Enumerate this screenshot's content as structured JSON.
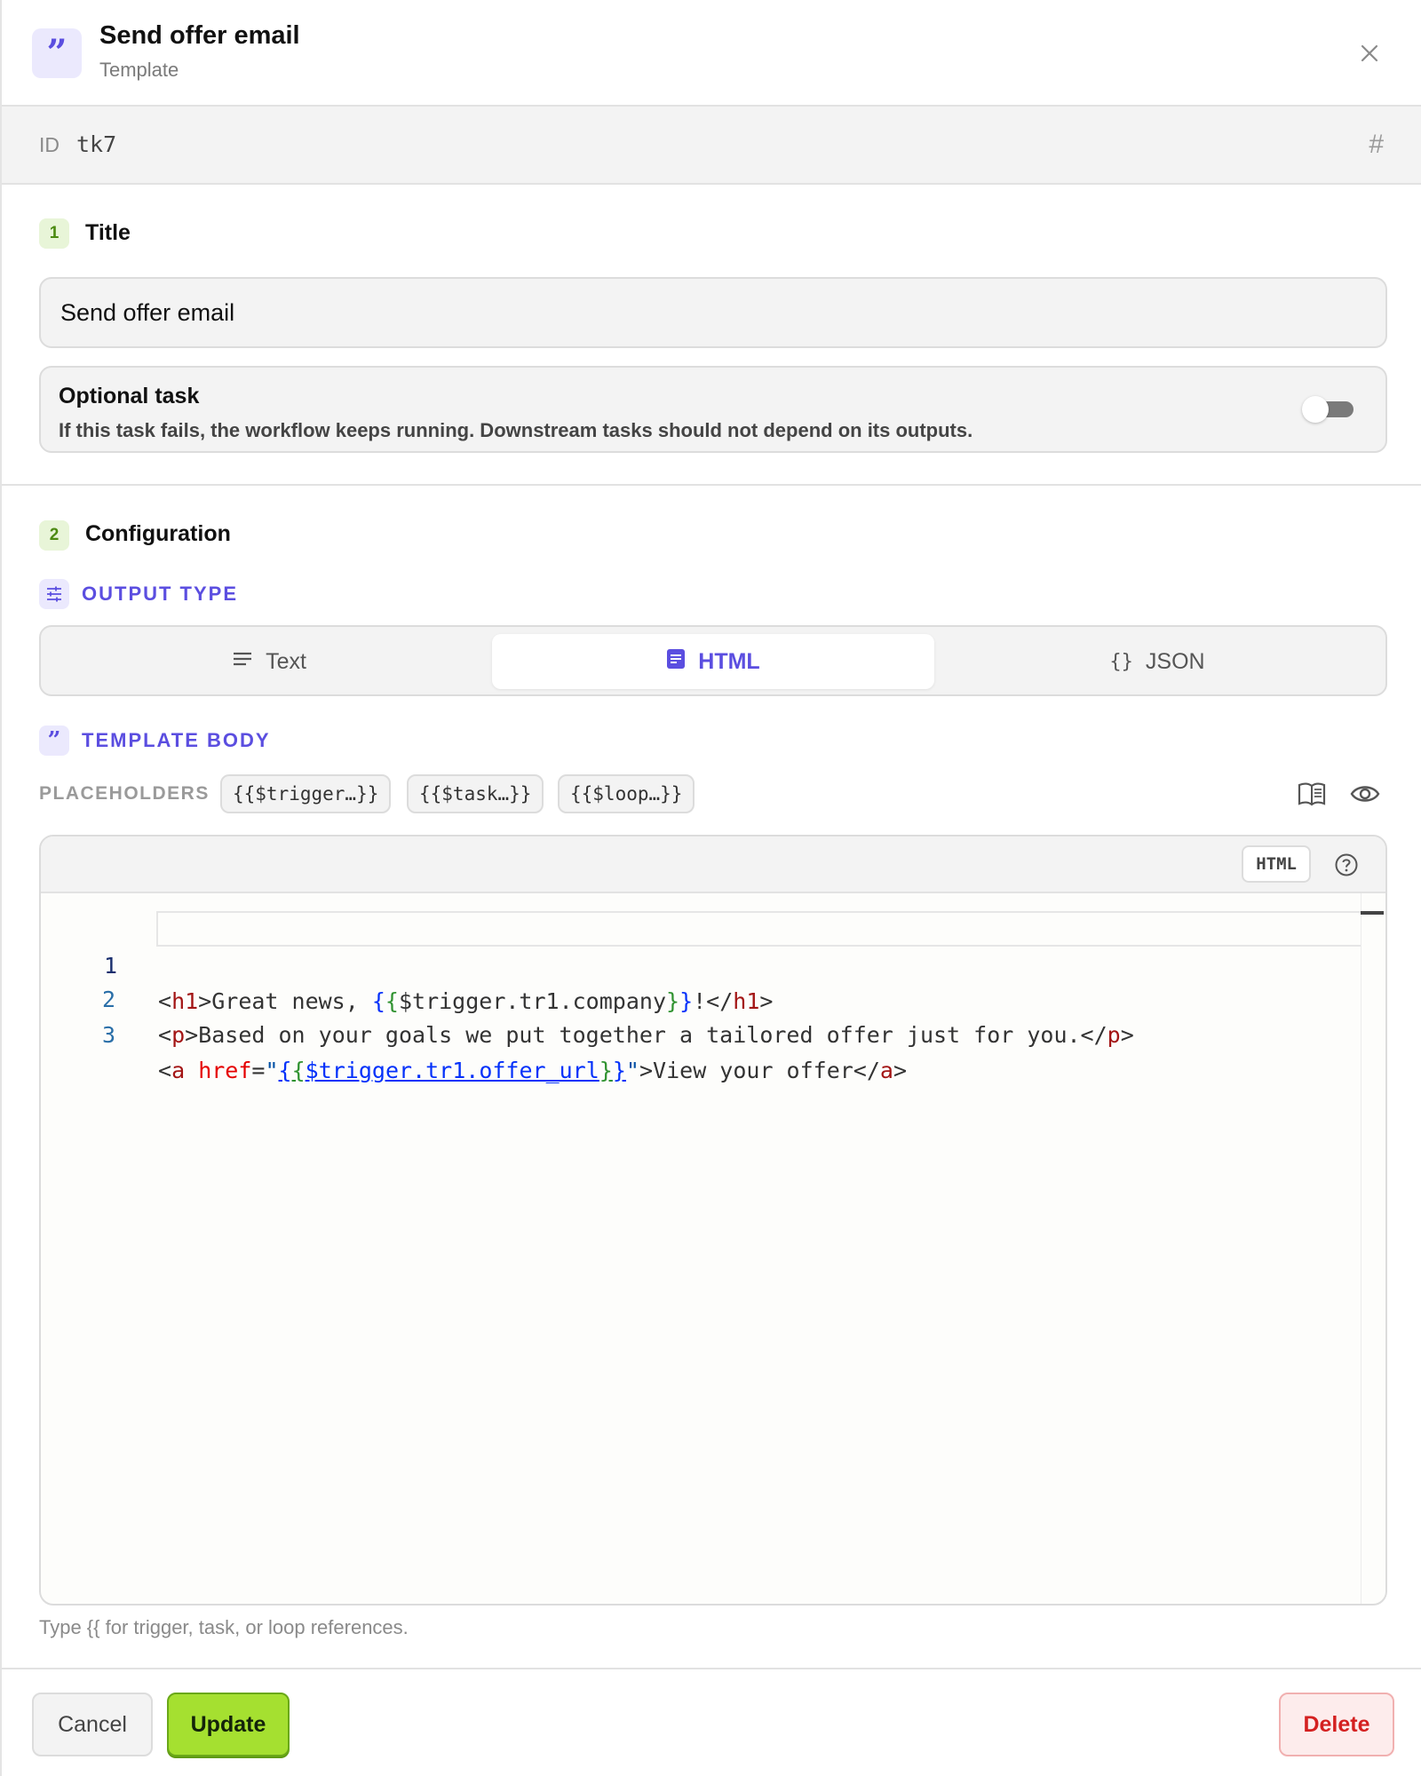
{
  "header": {
    "title": "Send offer email",
    "subtitle": "Template",
    "icon": "quote-icon"
  },
  "id_bar": {
    "label": "ID",
    "value": "tk7"
  },
  "section1": {
    "number": "1",
    "title": "Title",
    "title_value": "Send offer email",
    "optional": {
      "title": "Optional task",
      "description": "If this task fails, the workflow keeps running. Downstream tasks should not depend on its outputs.",
      "enabled": false
    }
  },
  "section2": {
    "number": "2",
    "title": "Configuration",
    "output_type": {
      "label": "OUTPUT TYPE",
      "options": [
        {
          "label": "Text",
          "icon": "lines-icon"
        },
        {
          "label": "HTML",
          "icon": "document-icon"
        },
        {
          "label": "JSON",
          "icon": "braces-icon"
        }
      ],
      "selected": "HTML"
    },
    "template_body": {
      "label": "TEMPLATE BODY",
      "placeholders_label": "PLACEHOLDERS",
      "placeholders": [
        "{{$trigger…}}",
        "{{$task…}}",
        "{{$loop…}}"
      ],
      "language": "HTML",
      "code_lines": [
        {
          "number": "1",
          "parts": [
            "<",
            "h1",
            ">Great news, ",
            "{",
            "{",
            "$trigger.tr1.company",
            "}",
            "}",
            "!</",
            "h1",
            ">"
          ]
        },
        {
          "number": "2",
          "parts": [
            "<",
            "p",
            ">Based on your goals we put together a tailored offer just for you.</",
            "p",
            ">"
          ]
        },
        {
          "number": "3",
          "parts": [
            "<",
            "a",
            " ",
            "href",
            "=",
            "\"",
            "{",
            "{",
            "$trigger.tr1.offer_url",
            "}",
            "}",
            "\"",
            ">View your offer</",
            "a",
            ">"
          ]
        }
      ],
      "hint": "Type {{ for trigger, task, or loop references."
    }
  },
  "footer": {
    "cancel": "Cancel",
    "update": "Update",
    "delete": "Delete"
  },
  "colors": {
    "accent": "#5b4ee0",
    "update_green": "#a5e030",
    "delete_red": "#d42020",
    "step_badge": "#4c8a12"
  }
}
